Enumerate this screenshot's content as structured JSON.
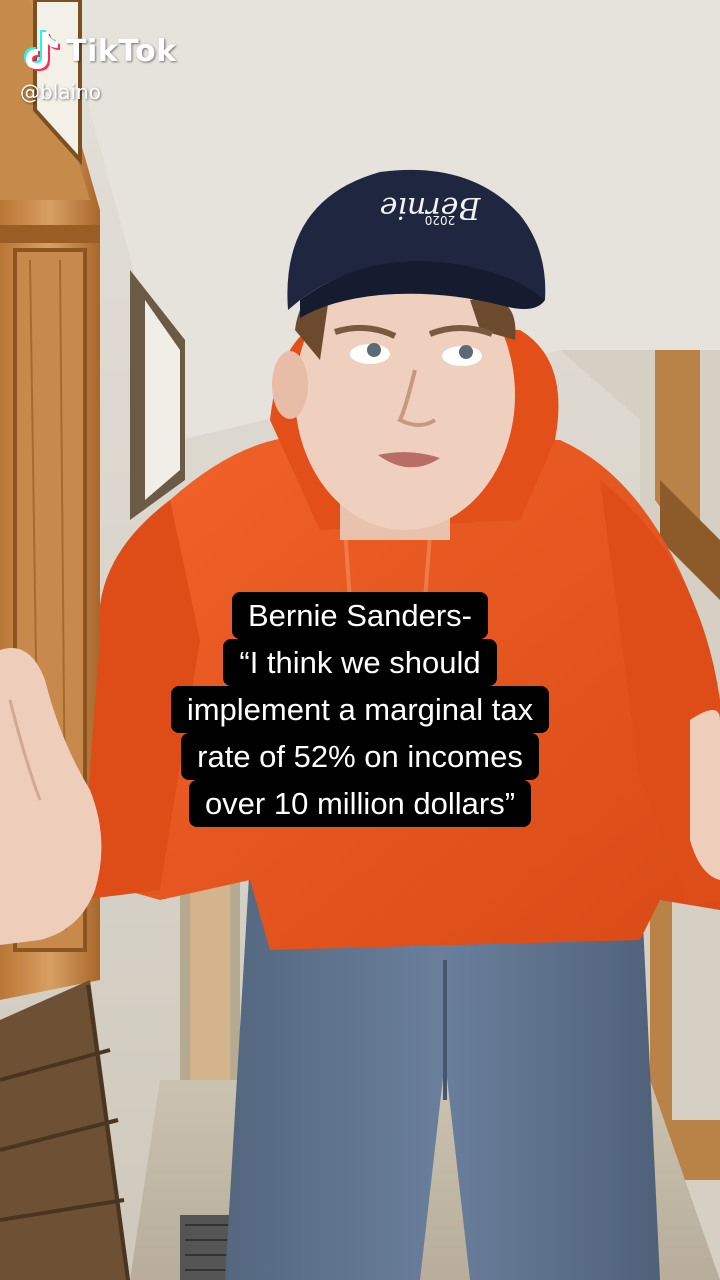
{
  "app": {
    "brand": "TikTok",
    "username": "@blaino"
  },
  "hat": {
    "text": "Bernie",
    "year": "2020"
  },
  "caption": {
    "lines": [
      "Bernie Sanders-",
      "“I think we should",
      "implement a marginal tax",
      "rate of 52% on incomes",
      "over 10 million dollars”"
    ]
  },
  "colors": {
    "hoodie": "#e8551f",
    "pants": "#5e7290",
    "cap": "#1f2740",
    "wood": "#c98a4d",
    "wall": "#d9d4c9",
    "caption_bg": "#000000",
    "text": "#ffffff",
    "tiktok_cyan": "#25f4ee",
    "tiktok_red": "#fe2c55"
  }
}
